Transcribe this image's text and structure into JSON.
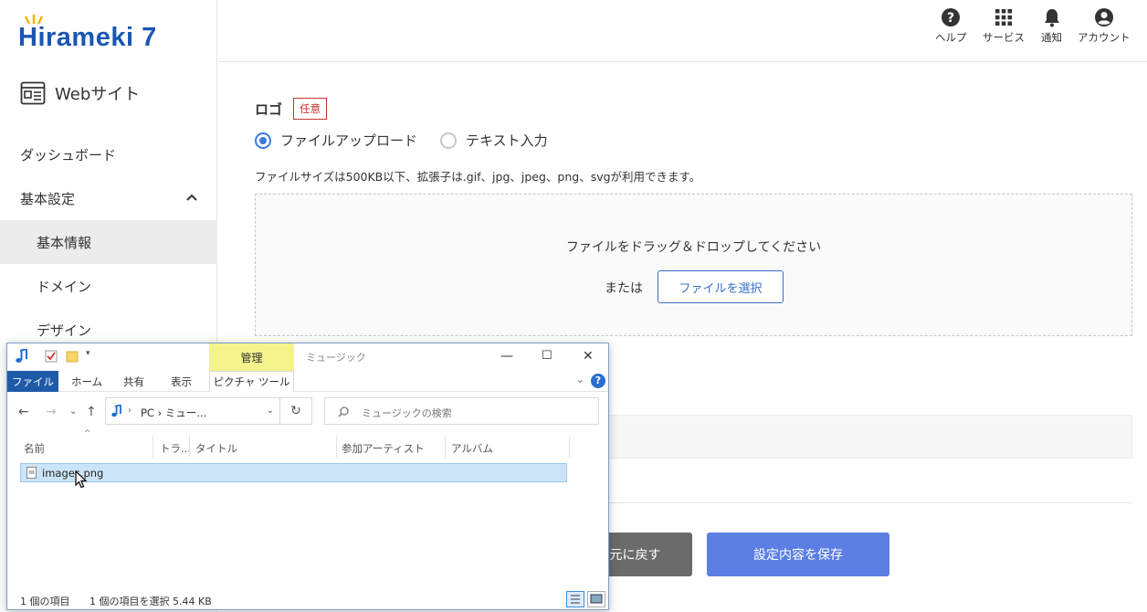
{
  "brand": {
    "logo_text": "Hirameki 7"
  },
  "sidebar": {
    "site_label": "Webサイト",
    "items": [
      {
        "label": "ダッシュボード"
      },
      {
        "label": "基本設定"
      },
      {
        "label": "基本情報"
      },
      {
        "label": "ドメイン"
      },
      {
        "label": "デザイン"
      }
    ]
  },
  "header": {
    "help": "ヘルプ",
    "services": "サービス",
    "notifications": "通知",
    "account": "アカウント"
  },
  "form": {
    "logo_label": "ロゴ",
    "optional_badge": "任意",
    "radio_file": "ファイルアップロード",
    "radio_text": "テキスト入力",
    "selected_radio": "ファイルアップロード",
    "size_note": "ファイルサイズは500KB以下、拡張子は.gif、jpg、jpeg、png、svgが利用できます。",
    "drop_text": "ファイルをドラッグ＆ドロップしてください",
    "or_text": "または",
    "choose_file": "ファイルを選択",
    "back_button": "に元に戻す",
    "save_button": "設定内容を保存"
  },
  "explorer": {
    "manage_tab": "管理",
    "window_title": "ミュージック",
    "ribbon_tabs": [
      "ファイル",
      "ホーム",
      "共有",
      "表示",
      "ピクチャ ツール"
    ],
    "address": "PC  ›  ミュー...",
    "search_placeholder": "ミュージックの検索",
    "columns": [
      "名前",
      "トラ...",
      "タイトル",
      "参加アーティスト",
      "アルバム"
    ],
    "files": [
      {
        "name": "images.png",
        "selected": true
      }
    ],
    "status_count": "1 個の項目",
    "status_selected": "1 個の項目を選択  5.44 KB"
  },
  "colors": {
    "brand": "#1a56b4",
    "primary": "#5b7fe3",
    "secondary": "#6b6b6b",
    "badge": "#c0392b",
    "explorer_file_tab": "#1e5aa8",
    "explorer_manage": "#f4f38c",
    "explorer_selection": "#cce4f7"
  }
}
